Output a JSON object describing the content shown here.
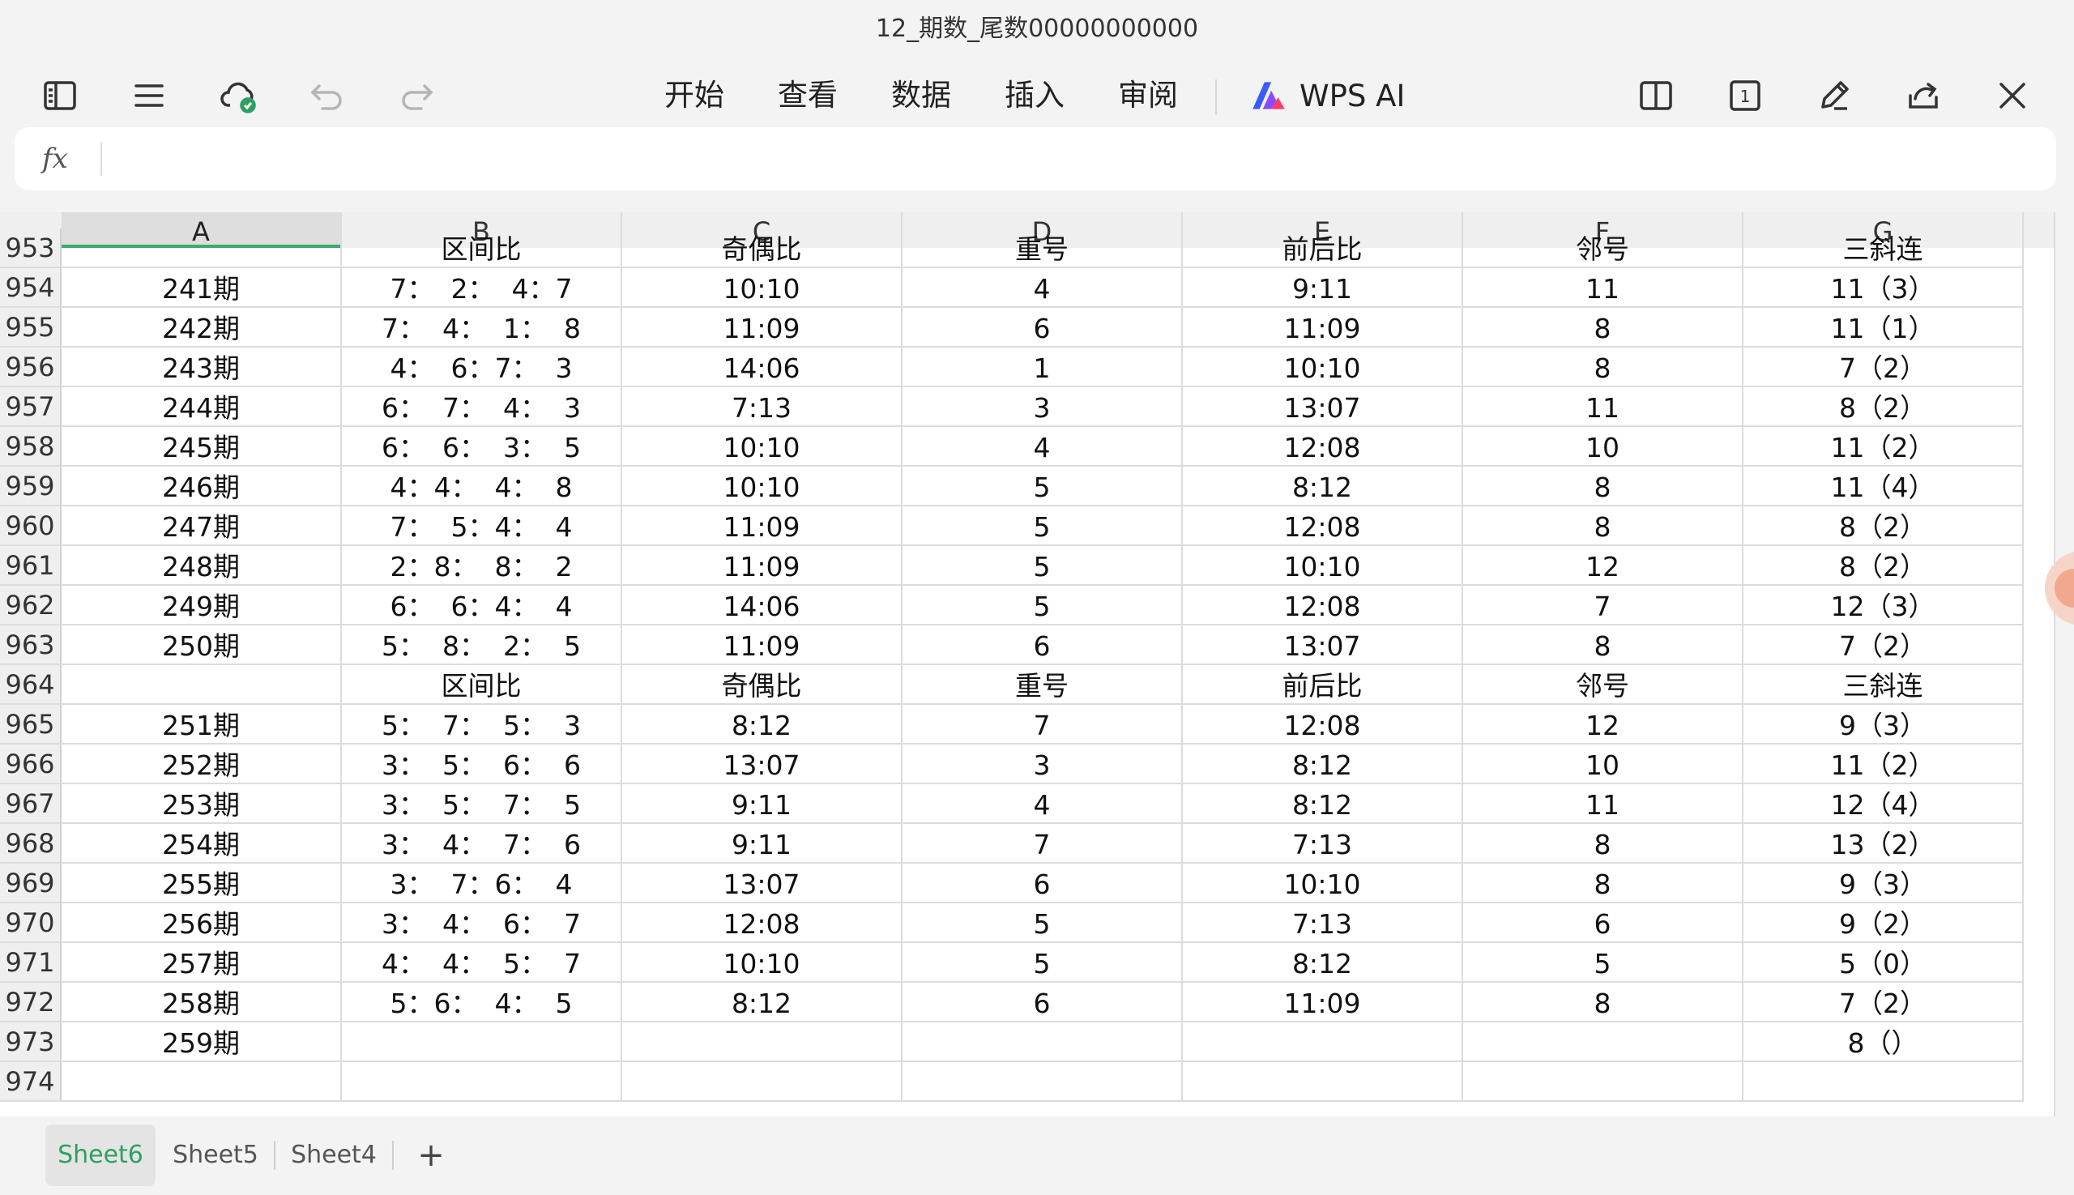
{
  "window": {
    "title": "12_期数_尾数00000000000"
  },
  "toolbar": {
    "menus": [
      "开始",
      "查看",
      "数据",
      "插入",
      "审阅"
    ],
    "ai_label": "WPS AI",
    "page_badge": "1"
  },
  "formula_bar": {
    "fx_label": "fx",
    "value": ""
  },
  "grid": {
    "columns": [
      "A",
      "B",
      "C",
      "D",
      "E",
      "F",
      "G"
    ],
    "selected_column": "A",
    "rows": [
      {
        "num": "953",
        "cells": [
          "",
          "区间比",
          "奇偶比",
          "重号",
          "前后比",
          "邻号",
          "三斜连"
        ]
      },
      {
        "num": "954",
        "cells": [
          "241期",
          "7：  2：  4：7",
          "10:10",
          "4",
          "9:11",
          "11",
          "11（3）"
        ]
      },
      {
        "num": "955",
        "cells": [
          "242期",
          "7：  4：  1：  8",
          "11:09",
          "6",
          "11:09",
          "8",
          "11（1）"
        ]
      },
      {
        "num": "956",
        "cells": [
          "243期",
          "4：  6：7：  3",
          "14:06",
          "1",
          "10:10",
          "8",
          "7（2）"
        ]
      },
      {
        "num": "957",
        "cells": [
          "244期",
          "6：  7：  4：  3",
          "7:13",
          "3",
          "13:07",
          "11",
          "8（2）"
        ]
      },
      {
        "num": "958",
        "cells": [
          "245期",
          "6：  6：  3：  5",
          "10:10",
          "4",
          "12:08",
          "10",
          "11（2）"
        ]
      },
      {
        "num": "959",
        "cells": [
          "246期",
          "4：4：  4：  8",
          "10:10",
          "5",
          "8:12",
          "8",
          "11（4）"
        ]
      },
      {
        "num": "960",
        "cells": [
          "247期",
          "7：  5：4：  4",
          "11:09",
          "5",
          "12:08",
          "8",
          "8（2）"
        ]
      },
      {
        "num": "961",
        "cells": [
          "248期",
          "2：8：  8：  2",
          "11:09",
          "5",
          "10:10",
          "12",
          "8（2）"
        ]
      },
      {
        "num": "962",
        "cells": [
          "249期",
          "6：  6：4：  4",
          "14:06",
          "5",
          "12:08",
          "7",
          "12（3）"
        ]
      },
      {
        "num": "963",
        "cells": [
          "250期",
          "5：  8：  2：  5",
          "11:09",
          "6",
          "13:07",
          "8",
          "7（2）"
        ]
      },
      {
        "num": "964",
        "cells": [
          "",
          "区间比",
          "奇偶比",
          "重号",
          "前后比",
          "邻号",
          "三斜连"
        ]
      },
      {
        "num": "965",
        "cells": [
          "251期",
          "5：  7：  5：  3",
          "8:12",
          "7",
          "12:08",
          "12",
          "9（3）"
        ]
      },
      {
        "num": "966",
        "cells": [
          "252期",
          "3：  5：  6：  6",
          "13:07",
          "3",
          "8:12",
          "10",
          "11（2）"
        ]
      },
      {
        "num": "967",
        "cells": [
          "253期",
          "3：  5：  7：  5",
          "9:11",
          "4",
          "8:12",
          "11",
          "12（4）"
        ]
      },
      {
        "num": "968",
        "cells": [
          "254期",
          "3：  4：  7：  6",
          "9:11",
          "7",
          "7:13",
          "8",
          "13（2）"
        ]
      },
      {
        "num": "969",
        "cells": [
          "255期",
          "3：  7：6：  4",
          "13:07",
          "6",
          "10:10",
          "8",
          "9（3）"
        ]
      },
      {
        "num": "970",
        "cells": [
          "256期",
          "3：  4：  6：  7",
          "12:08",
          "5",
          "7:13",
          "6",
          "9（2）"
        ]
      },
      {
        "num": "971",
        "cells": [
          "257期",
          "4：  4：  5：  7",
          "10:10",
          "5",
          "8:12",
          "5",
          "5（0）"
        ]
      },
      {
        "num": "972",
        "cells": [
          "258期",
          "5：6：  4：  5",
          "8:12",
          "6",
          "11:09",
          "8",
          "7（2）"
        ]
      },
      {
        "num": "973",
        "cells": [
          "259期",
          "",
          "",
          "",
          "",
          "",
          "8（）"
        ]
      },
      {
        "num": "974",
        "cells": [
          "",
          "",
          "",
          "",
          "",
          "",
          ""
        ]
      }
    ]
  },
  "sheets": {
    "tabs": [
      "Sheet6",
      "Sheet5",
      "Sheet4"
    ],
    "active": "Sheet6",
    "add_label": "+"
  },
  "colors": {
    "accent": "#2f9e63",
    "selection_underline": "#3eaa6f"
  }
}
